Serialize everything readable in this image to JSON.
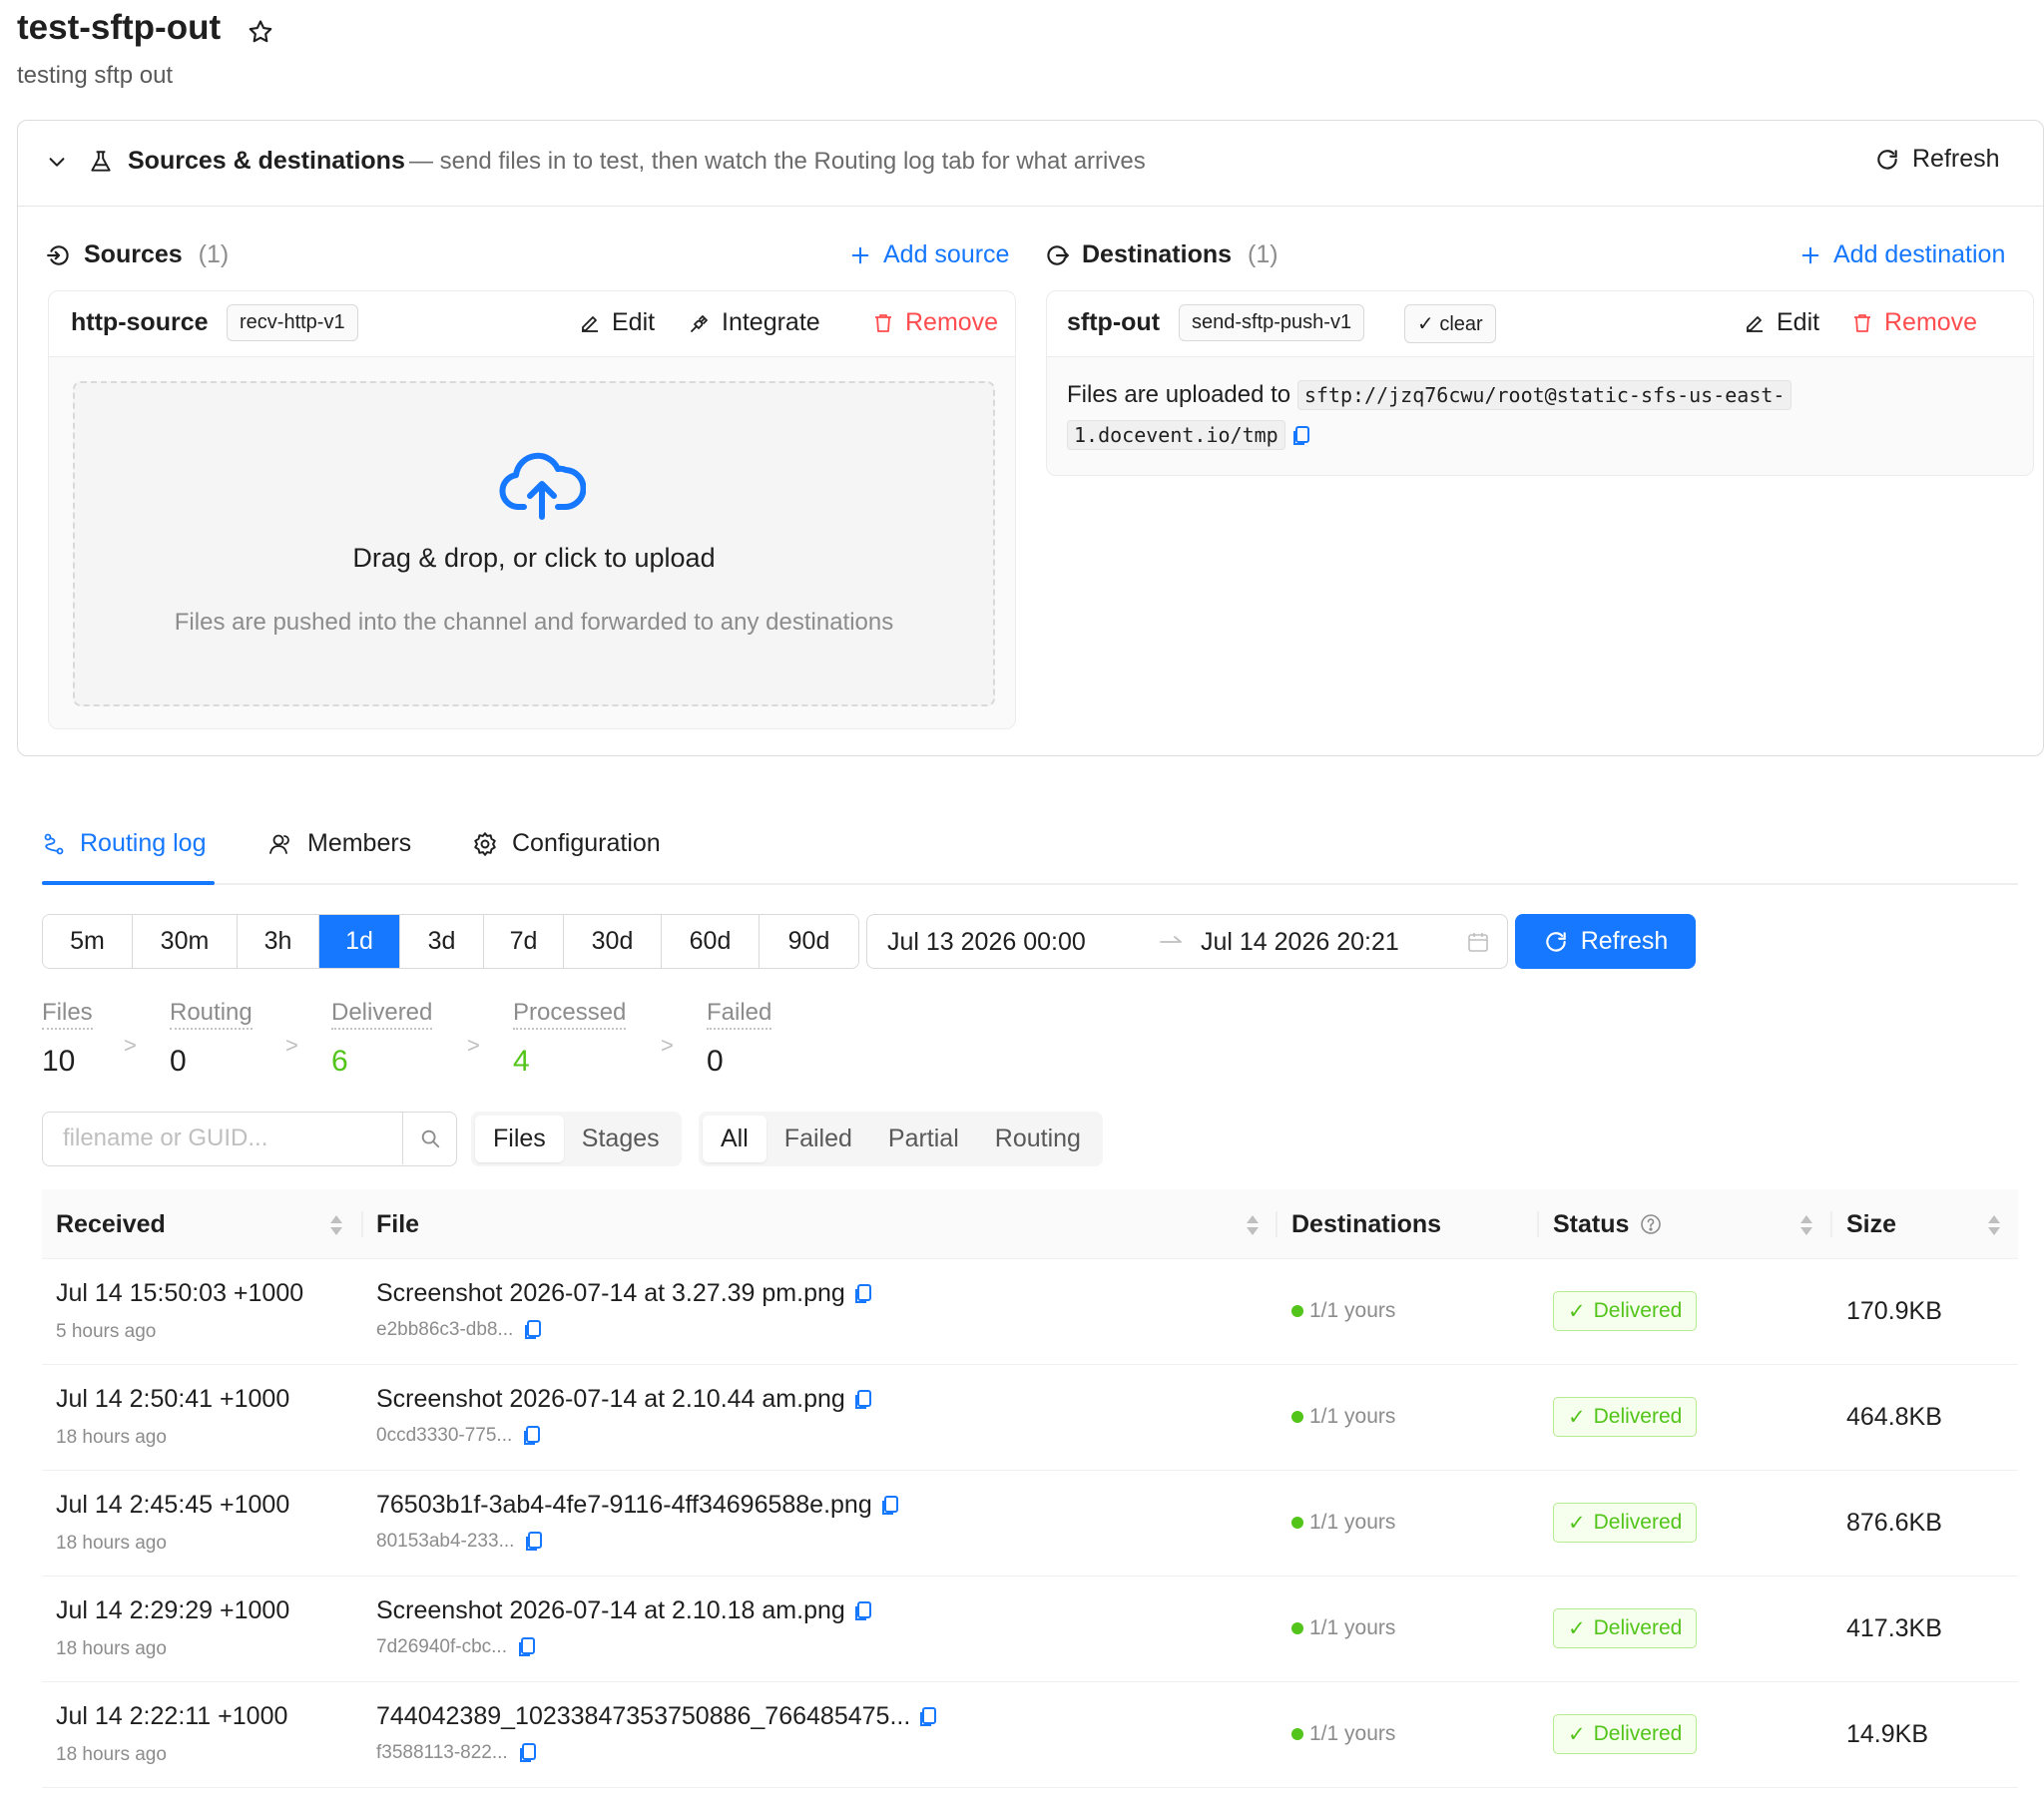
{
  "header": {
    "title": "test-sftp-out",
    "subtitle": "testing sftp out"
  },
  "sources_destinations": {
    "title": "Sources & destinations",
    "description": "— send files in to test, then watch the Routing log tab for what arrives",
    "refresh_label": "Refresh",
    "sources": {
      "heading": "Sources",
      "count": "(1)",
      "add_label": "Add source",
      "item": {
        "name": "http-source",
        "tag": "recv-http-v1",
        "edit_label": "Edit",
        "integrate_label": "Integrate",
        "remove_label": "Remove",
        "dropzone_title": "Drag & drop, or click to upload",
        "dropzone_hint": "Files are pushed into the channel and forwarded to any destinations"
      }
    },
    "destinations": {
      "heading": "Destinations",
      "count": "(1)",
      "add_label": "Add destination",
      "item": {
        "name": "sftp-out",
        "tag": "send-sftp-push-v1",
        "status_tag": "✓ clear",
        "edit_label": "Edit",
        "remove_label": "Remove",
        "upload_prefix": "Files are uploaded to",
        "upload_path_line1": "sftp://jzq76cwu/root@static-sfs-us-east-",
        "upload_path_line2": "1.docevent.io/tmp"
      }
    }
  },
  "tabs": [
    {
      "label": "Routing log",
      "active": true,
      "icon": "routing-icon"
    },
    {
      "label": "Members",
      "active": false,
      "icon": "members-icon"
    },
    {
      "label": "Configuration",
      "active": false,
      "icon": "gear-icon"
    }
  ],
  "time_ranges": [
    "5m",
    "30m",
    "3h",
    "1d",
    "3d",
    "7d",
    "30d",
    "60d",
    "90d"
  ],
  "selected_range": "1d",
  "date_range": {
    "start": "Jul 13 2026 00:00",
    "end": "Jul 14 2026 20:21"
  },
  "refresh_button": "Refresh",
  "stats": [
    {
      "label": "Files",
      "value": "10"
    },
    {
      "label": "Routing",
      "value": "0"
    },
    {
      "label": "Delivered",
      "value": "6"
    },
    {
      "label": "Processed",
      "value": "4"
    },
    {
      "label": "Failed",
      "value": "0"
    }
  ],
  "search": {
    "placeholder": "filename or GUID..."
  },
  "view_toggle": [
    "Files",
    "Stages"
  ],
  "status_filter": [
    "All",
    "Failed",
    "Partial",
    "Routing"
  ],
  "table": {
    "columns": [
      "Received",
      "File",
      "Destinations",
      "Status",
      "Size"
    ],
    "rows": [
      {
        "received": "Jul 14 15:50:03 +1000",
        "ago": "5 hours ago",
        "file": "Screenshot 2026-07-14 at 3.27.39 pm.png",
        "guid": "e2bb86c3-db8...",
        "destinations": "1/1 yours",
        "status": "Delivered",
        "size": "170.9KB"
      },
      {
        "received": "Jul 14 2:50:41 +1000",
        "ago": "18 hours ago",
        "file": "Screenshot 2026-07-14 at 2.10.44 am.png",
        "guid": "0ccd3330-775...",
        "destinations": "1/1 yours",
        "status": "Delivered",
        "size": "464.8KB"
      },
      {
        "received": "Jul 14 2:45:45 +1000",
        "ago": "18 hours ago",
        "file": "76503b1f-3ab4-4fe7-9116-4ff34696588e.png",
        "guid": "80153ab4-233...",
        "destinations": "1/1 yours",
        "status": "Delivered",
        "size": "876.6KB"
      },
      {
        "received": "Jul 14 2:29:29 +1000",
        "ago": "18 hours ago",
        "file": "Screenshot 2026-07-14 at 2.10.18 am.png",
        "guid": "7d26940f-cbc...",
        "destinations": "1/1 yours",
        "status": "Delivered",
        "size": "417.3KB"
      },
      {
        "received": "Jul 14 2:22:11 +1000",
        "ago": "18 hours ago",
        "file": "744042389_10233847353750886_766485475...",
        "guid": "f3588113-822...",
        "destinations": "1/1 yours",
        "status": "Delivered",
        "size": "14.9KB"
      }
    ]
  },
  "colors": {
    "accent": "#1677ff",
    "danger": "#ff4d4f",
    "success": "#52c41a"
  }
}
